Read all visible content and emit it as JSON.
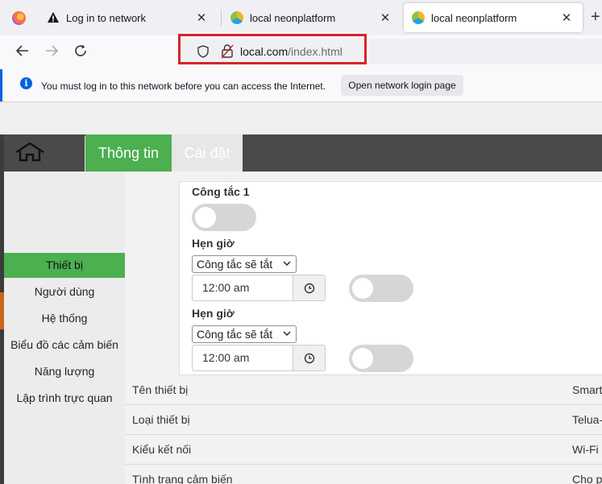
{
  "browser": {
    "tabs": [
      {
        "title": "Log in to network",
        "icon": "warning-icon"
      },
      {
        "title": "local neonplatform",
        "icon": "site-icon"
      },
      {
        "title": "local neonplatform",
        "icon": "site-icon",
        "active": true
      }
    ],
    "url_host": "local.com",
    "url_path": "/index.html"
  },
  "notification": {
    "message": "You must log in to this network before you can access the Internet.",
    "button_label": "Open network login page"
  },
  "app": {
    "tabs": {
      "info": "Thông tin",
      "settings": "Cài đặt"
    },
    "sidebar": [
      {
        "label": "Thiết bị",
        "active": true
      },
      {
        "label": "Người dùng"
      },
      {
        "label": "Hệ thống"
      },
      {
        "label": "Biểu đồ các cảm biến"
      },
      {
        "label": "Năng lượng"
      },
      {
        "label": "Lập trình trực quan"
      }
    ],
    "switch": {
      "label": "Công tắc 1",
      "on": false
    },
    "timers": [
      {
        "label": "Hẹn giờ",
        "action": "Công tắc sẽ tắt",
        "time": "12:00 am",
        "enabled": false
      },
      {
        "label": "Hẹn giờ",
        "action": "Công tắc sẽ tắt",
        "time": "12:00 am",
        "enabled": false
      }
    ],
    "info_rows": [
      {
        "key": "Tên thiết bị",
        "value": "Smart"
      },
      {
        "key": "Loại thiết bị",
        "value": "Telua-"
      },
      {
        "key": "Kiểu kết nối",
        "value": "Wi-Fi"
      },
      {
        "key": "Tình trạng cảm biến",
        "value": "Cho p"
      }
    ]
  },
  "colors": {
    "accent_green": "#4caf50",
    "header_dark": "#4a4a4a",
    "url_highlight": "#d8232a"
  }
}
